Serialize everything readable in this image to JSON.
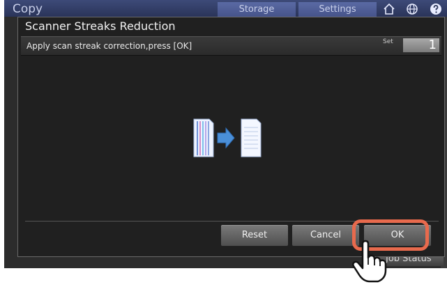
{
  "topbar": {
    "title": "Copy",
    "tabs": [
      {
        "label": "Storage"
      },
      {
        "label": "Settings"
      }
    ],
    "icons": [
      "home-icon",
      "globe-icon",
      "help-icon"
    ]
  },
  "dialog": {
    "title": "Scanner Streaks Reduction",
    "message": "Apply scan streak correction,press [OK]",
    "set_label": "Set",
    "set_value": "1",
    "illustration_icon": "streak-correction-icon",
    "buttons": {
      "reset": "Reset",
      "cancel": "Cancel",
      "ok": "OK"
    }
  },
  "footer": {
    "job_status": "Job Status"
  },
  "colors": {
    "highlight": "#e86a4d",
    "topbar": "#2f3a63"
  }
}
